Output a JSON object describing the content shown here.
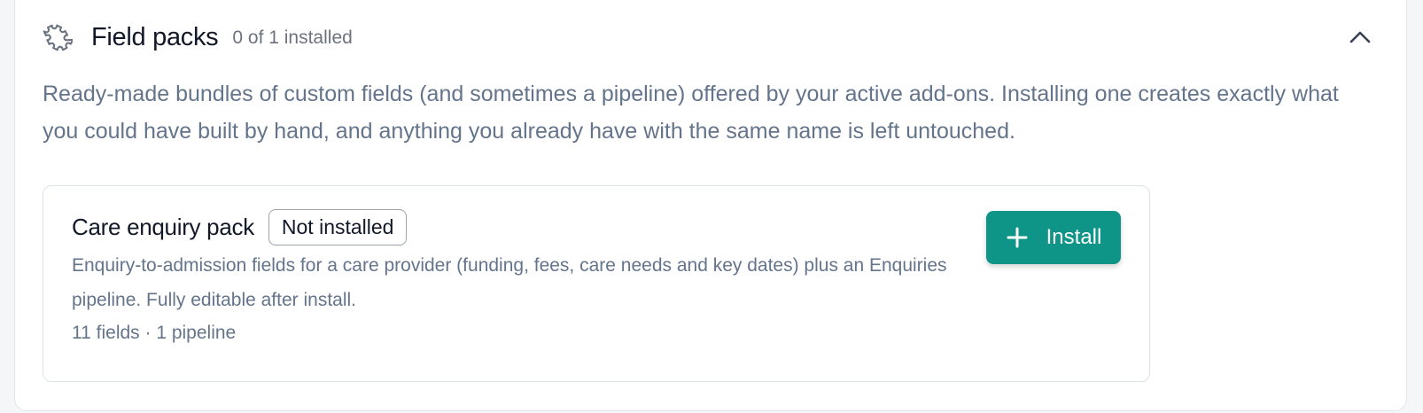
{
  "header": {
    "title": "Field packs",
    "installed_count": "0 of 1 installed",
    "icon": "puzzle-icon",
    "collapse_icon": "chevron-up-icon"
  },
  "description": "Ready-made bundles of custom fields (and sometimes a pipeline) offered by your active add-ons. Installing one creates exactly what you could have built by hand, and anything you already have with the same name is left untouched.",
  "packs": [
    {
      "name": "Care enquiry pack",
      "status": "Not installed",
      "description": "Enquiry-to-admission fields for a care provider (funding, fees, care needs and key dates) plus an Enquiries pipeline. Fully editable after install.",
      "meta": "11 fields · 1 pipeline",
      "install_label": "Install",
      "install_icon": "plus-icon"
    }
  ],
  "colors": {
    "accent": "#0f9488",
    "text_primary": "#111827",
    "text_muted": "#64748b"
  }
}
